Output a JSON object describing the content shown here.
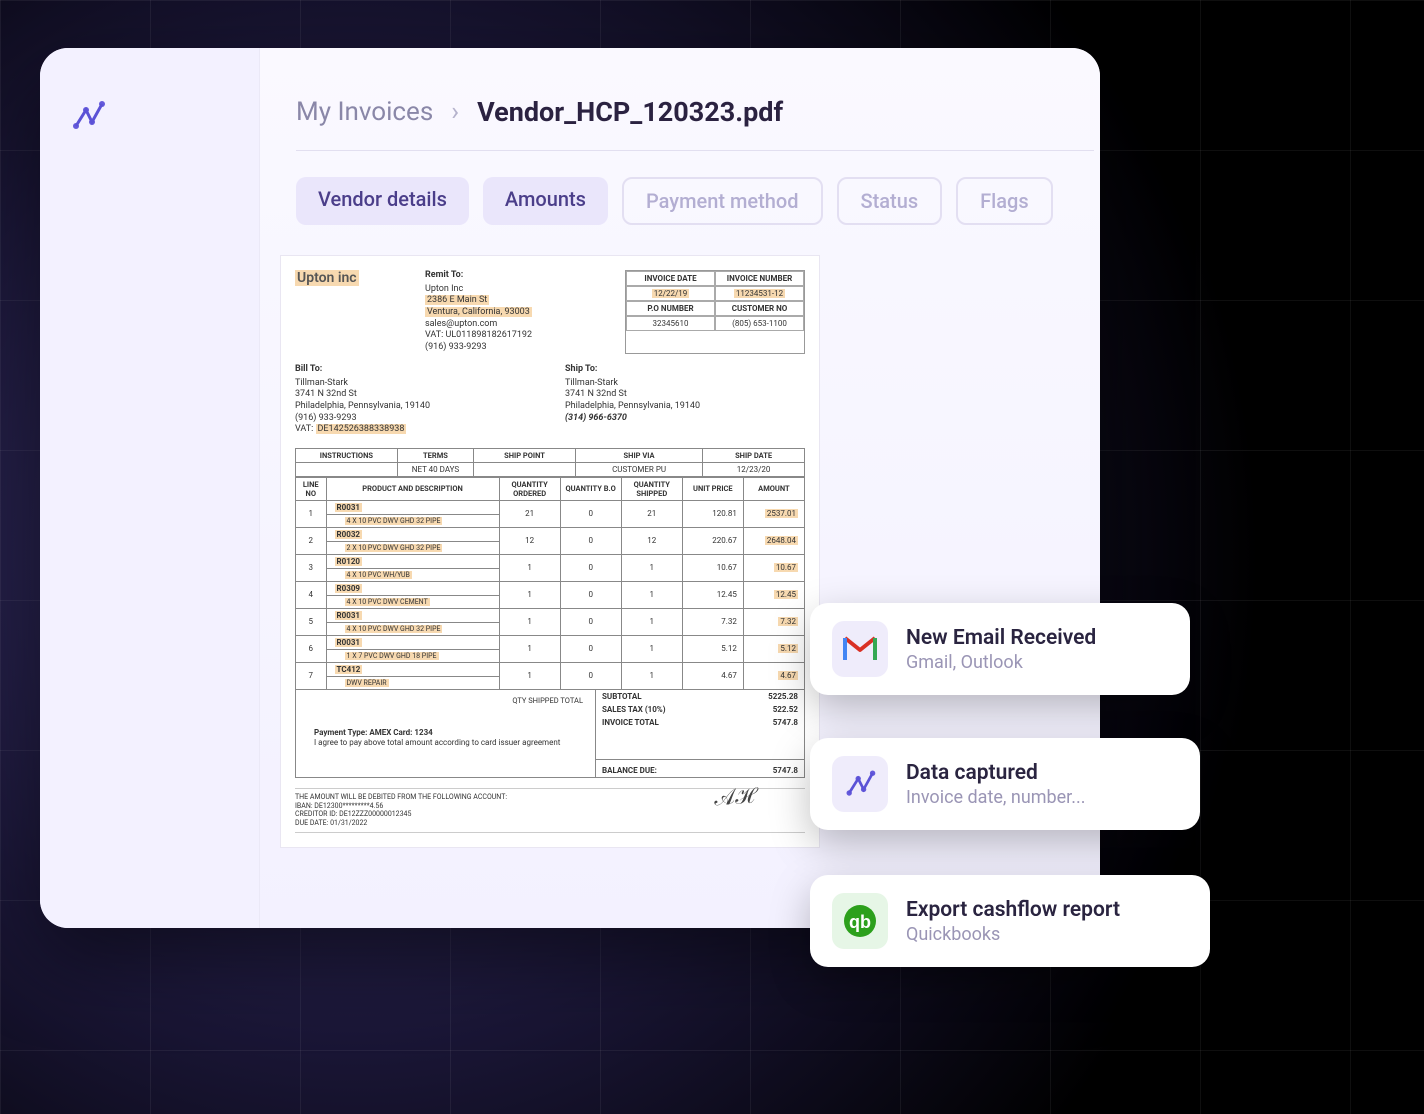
{
  "breadcrumb": {
    "root": "My Invoices",
    "current": "Vendor_HCP_120323.pdf"
  },
  "tabs": [
    {
      "label": "Vendor details",
      "style": "filled"
    },
    {
      "label": "Amounts",
      "style": "filled"
    },
    {
      "label": "Payment method",
      "style": "outline"
    },
    {
      "label": "Status",
      "style": "outline"
    },
    {
      "label": "Flags",
      "style": "outline"
    }
  ],
  "invoice": {
    "vendor_name": "Upton inc",
    "remit_to_label": "Remit To:",
    "remit_to": {
      "name": "Upton Inc",
      "street": "2386 E Main St",
      "city_line": "Ventura, California, 93003",
      "email": "sales@upton.com",
      "vat": "VAT: UL011898182617192",
      "phone": "(916) 933-9293"
    },
    "meta_headers": {
      "inv_date": "INVOICE DATE",
      "inv_no": "INVOICE NUMBER",
      "po": "P.O NUMBER",
      "cust": "CUSTOMER NO"
    },
    "meta_values": {
      "inv_date": "12/22/19",
      "inv_no": "11234531-12",
      "po": "32345610",
      "cust": "(805) 653-1100"
    },
    "bill_to_label": "Bill To:",
    "bill_to": {
      "name": "Tillman-Stark",
      "street": "3741 N 32nd St",
      "city": "Philadelphia, Pennsylvania, 19140",
      "phone": "(916) 933-9293",
      "vat": "VAT: DE142526388338938"
    },
    "ship_to_label": "Ship To:",
    "ship_to": {
      "name": "Tillman-Stark",
      "street": "3741 N 32nd St",
      "city": "Philadelphia, Pennsylvania, 19140",
      "phone": "(314) 966-6370"
    },
    "terms_header": {
      "instructions": "INSTRUCTIONS",
      "terms": "TERMS",
      "ship_point": "SHIP POINT",
      "ship_via": "SHIP VIA",
      "ship_date": "SHIP DATE"
    },
    "terms_row": {
      "instructions": "",
      "terms": "NET 40 DAYS",
      "ship_point": "",
      "ship_via": "CUSTOMER PU",
      "ship_date": "12/23/20"
    },
    "item_header": {
      "line": "LINE NO",
      "prod": "PRODUCT AND DESCRIPTION",
      "qord": "QUANTITY ORDERED",
      "qbo": "QUANTITY B.O",
      "qship": "QUANTITY SHIPPED",
      "uprice": "UNIT PRICE",
      "amount": "AMOUNT"
    },
    "items": [
      {
        "line": "1",
        "code": "R0031",
        "desc": "4 X 10 PVC DWV GHD 32 PIPE",
        "qord": "21",
        "qbo": "0",
        "qship": "21",
        "uprice": "120.81",
        "amount": "2537.01"
      },
      {
        "line": "2",
        "code": "R0032",
        "desc": "2 X 10 PVC DWV GHD 32 PIPE",
        "qord": "12",
        "qbo": "0",
        "qship": "12",
        "uprice": "220.67",
        "amount": "2648.04"
      },
      {
        "line": "3",
        "code": "R0120",
        "desc": "4 X 10 PVC WH/YUB",
        "qord": "1",
        "qbo": "0",
        "qship": "1",
        "uprice": "10.67",
        "amount": "10.67"
      },
      {
        "line": "4",
        "code": "R0309",
        "desc": "4 X 10 PVC DWV CEMENT",
        "qord": "1",
        "qbo": "0",
        "qship": "1",
        "uprice": "12.45",
        "amount": "12.45"
      },
      {
        "line": "5",
        "code": "R0031",
        "desc": "4 X 10 PVC DWV GHD 32 PIPE",
        "qord": "1",
        "qbo": "0",
        "qship": "1",
        "uprice": "7.32",
        "amount": "7.32"
      },
      {
        "line": "6",
        "code": "R0031",
        "desc": "1 X 7 PVC DWV GHD 18 PIPE",
        "qord": "1",
        "qbo": "0",
        "qship": "1",
        "uprice": "5.12",
        "amount": "5.12"
      },
      {
        "line": "7",
        "code": "TC412",
        "desc": "DWV REPAIR",
        "qord": "1",
        "qbo": "0",
        "qship": "1",
        "uprice": "4.67",
        "amount": "4.67"
      }
    ],
    "qty_shipped_total_label": "QTY SHIPPED TOTAL",
    "payment_line1": "Payment Type: AMEX Card: 1234",
    "payment_line2": "I agree to pay above total amount according to card issuer agreement",
    "subtotal_label": "SUBTOTAL",
    "subtotal": "5225.28",
    "salestax_label": "SALES TAX (10%)",
    "salestax": "522.52",
    "invoice_total_label": "INVOICE TOTAL",
    "invoice_total": "5747.8",
    "balance_due_label": "BALANCE DUE:",
    "balance_due": "5747.8",
    "fine_print": {
      "l1": "THE AMOUNT WILL BE DEBITED FROM THE FOLLOWING ACCOUNT:",
      "l2": "IBAN: DE12300*********4.56",
      "l3": "CREDITOR ID: DE12ZZZ00000012345",
      "l4": "DUE DATE: 01/31/2022"
    }
  },
  "cards": {
    "c1": {
      "title": "New Email Received",
      "sub": "Gmail, Outlook"
    },
    "c2": {
      "title": "Data captured",
      "sub": "Invoice date, number..."
    },
    "c3": {
      "title": "Export cashflow report",
      "sub": "Quickbooks"
    }
  }
}
